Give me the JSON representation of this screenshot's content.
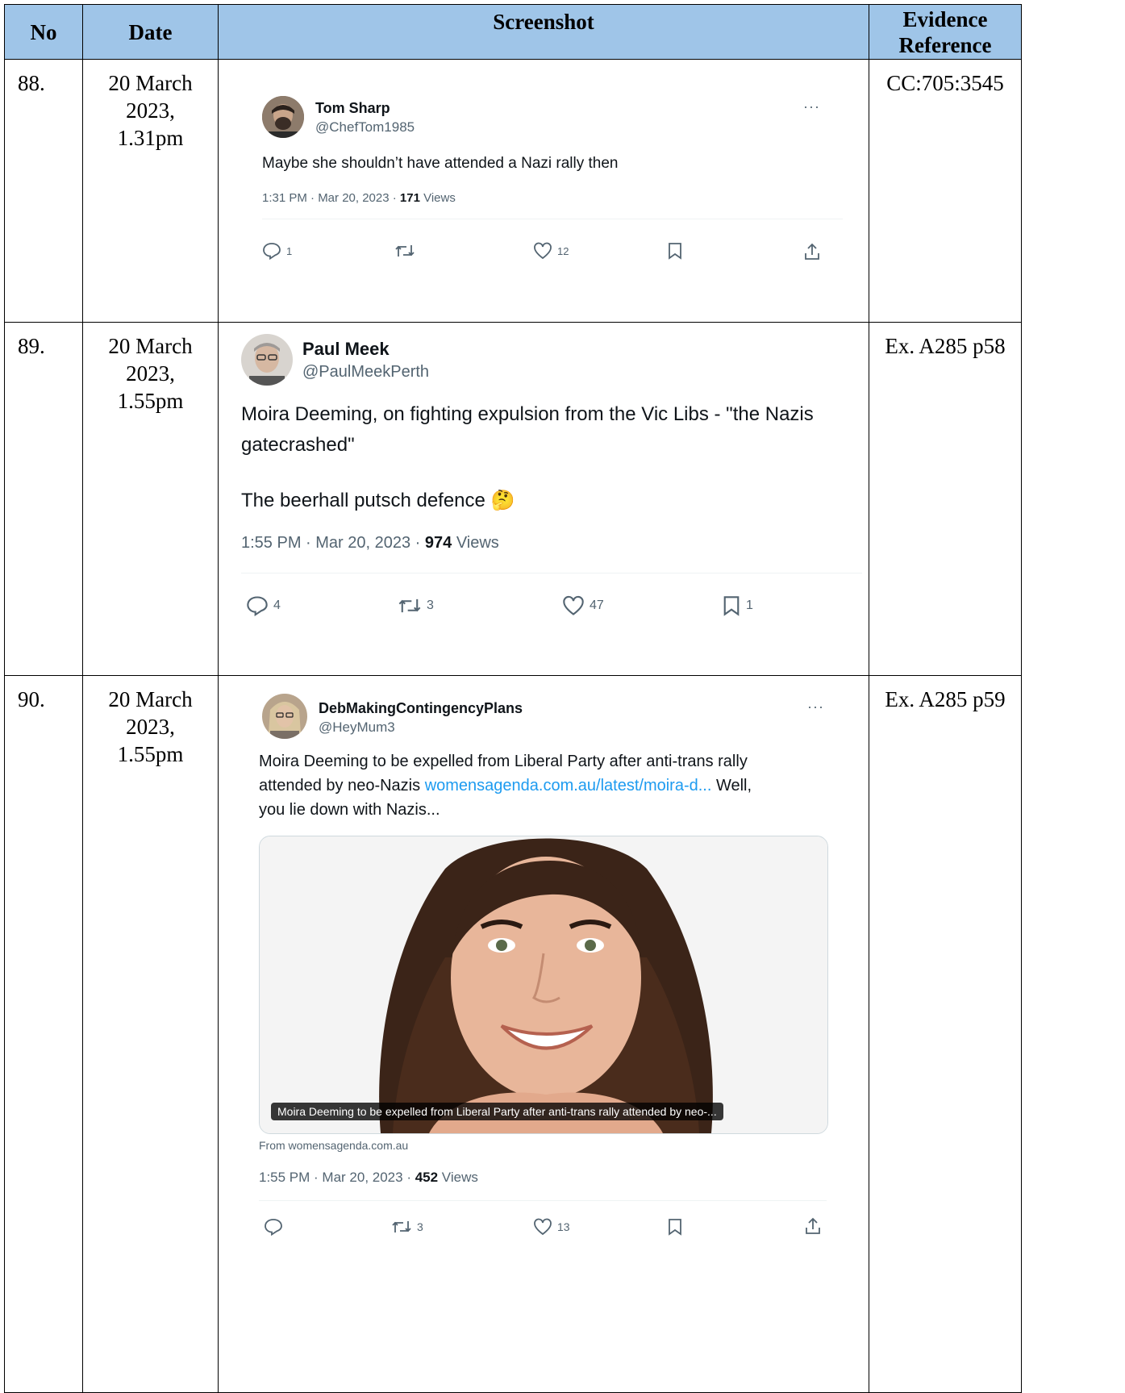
{
  "table": {
    "headers": {
      "no": "No",
      "date": "Date",
      "screenshot": "Screenshot",
      "evidence_line1": "Evidence",
      "evidence_line2": "Reference"
    },
    "rows": [
      {
        "no": "88.",
        "date_line1": "20 March",
        "date_line2": "2023,",
        "date_line3": "1.31pm",
        "reference": "CC:705:3545",
        "tweet": {
          "name": "Tom Sharp",
          "handle": "@ChefTom1985",
          "text": "Maybe she shouldn’t have attended a Nazi rally then",
          "time": "1:31 PM · Mar 20, 2023 · ",
          "views": "171",
          "views_label": " Views",
          "replies": "1",
          "retweets": "",
          "likes": "12",
          "more": "···"
        }
      },
      {
        "no": "89.",
        "date_line1": "20 March",
        "date_line2": "2023,",
        "date_line3": "1.55pm",
        "reference": "Ex. A285 p58",
        "tweet": {
          "name": "Paul Meek",
          "handle": "@PaulMeekPerth",
          "text_line1": "Moira Deeming, on fighting expulsion from the Vic Libs - \"the Nazis",
          "text_line2": "gatecrashed\"",
          "text_line3": "The beerhall putsch defence 🤔",
          "time": "1:55 PM · Mar 20, 2023 · ",
          "views": "974",
          "views_label": " Views",
          "replies": "4",
          "retweets": "3",
          "likes": "47",
          "bookmarks": "1"
        }
      },
      {
        "no": "90.",
        "date_line1": "20 March",
        "date_line2": "2023,",
        "date_line3": "1.55pm",
        "reference": "Ex. A285 p59",
        "tweet": {
          "name": "DebMakingContingencyPlans",
          "handle": "@HeyMum3",
          "text_line1": "Moira Deeming to be expelled from Liberal Party after anti-trans rally",
          "text_line2_a": "attended by neo-Nazis ",
          "text_line2_link": "womensagenda.com.au/latest/moira-d...",
          "text_line2_b": " Well,",
          "text_line3": "you lie down with Nazis...",
          "card_caption": "Moira Deeming to be expelled from Liberal Party after anti-trans rally attended by neo-...",
          "card_source": "From womensagenda.com.au",
          "time": "1:55 PM · Mar 20, 2023 · ",
          "views": "452",
          "views_label": " Views",
          "replies": "",
          "retweets": "3",
          "likes": "13",
          "more": "···"
        }
      }
    ]
  },
  "colors": {
    "header_bg": "#9fc5e8",
    "text": "#0f1419",
    "muted": "#536471",
    "link": "#1d9bf0"
  }
}
